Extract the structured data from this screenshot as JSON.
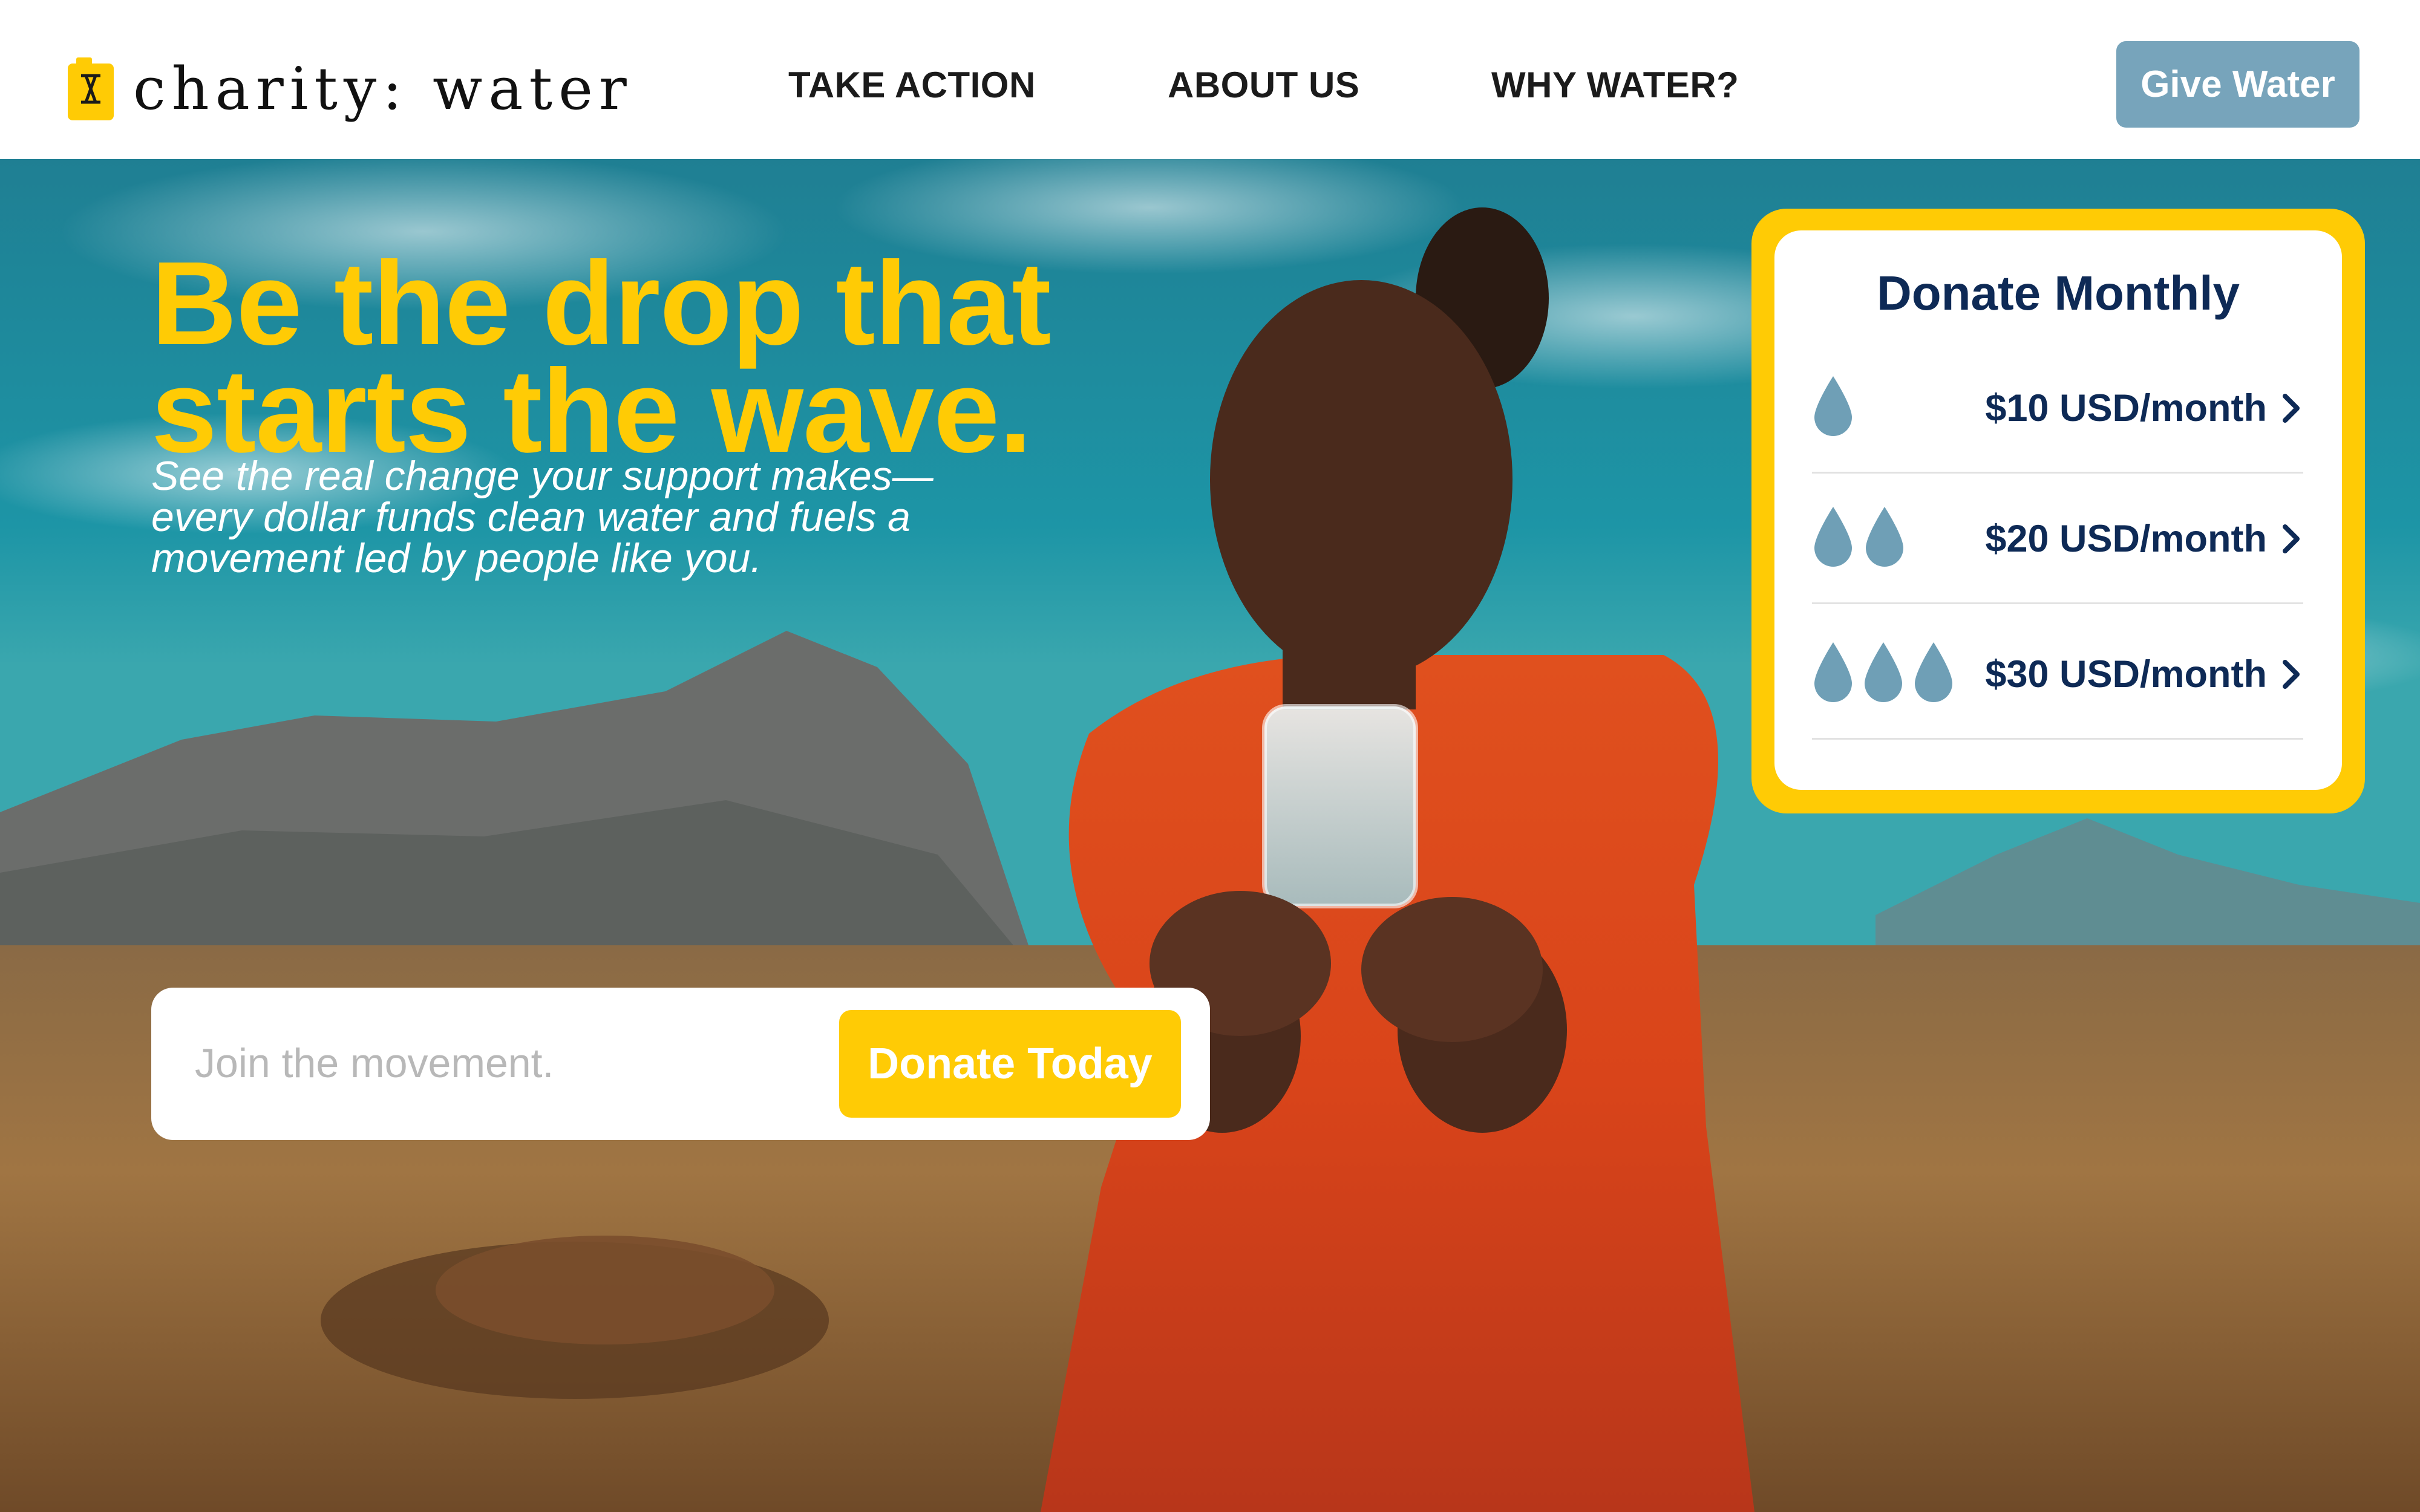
{
  "header": {
    "logo_text": "charity: water",
    "nav": [
      {
        "label": "TAKE ACTION"
      },
      {
        "label": "ABOUT US"
      },
      {
        "label": "WHY WATER?"
      }
    ],
    "cta_label": "Give Water"
  },
  "hero": {
    "headline_line1": "Be the drop that",
    "headline_line2": "starts the wave.",
    "subhead_line1": "See the real change your support makes—",
    "subhead_line2": "every dollar funds clean water and fuels a",
    "subhead_line3": "movement led by people like you.",
    "image_icon": "girl-holding-water-glass-photo"
  },
  "monthly": {
    "title": "Donate Monthly",
    "tiers": [
      {
        "label": "$10 USD/month",
        "drops": 1
      },
      {
        "label": "$20 USD/month",
        "drops": 2
      },
      {
        "label": "$30 USD/month",
        "drops": 3
      }
    ]
  },
  "join": {
    "placeholder": "Join the movement.",
    "button_label": "Donate Today"
  },
  "colors": {
    "brand_yellow": "#ffcb05",
    "navy": "#0e2a56",
    "give_button": "#77a4bb",
    "drop_blue": "#6f9fb6"
  }
}
